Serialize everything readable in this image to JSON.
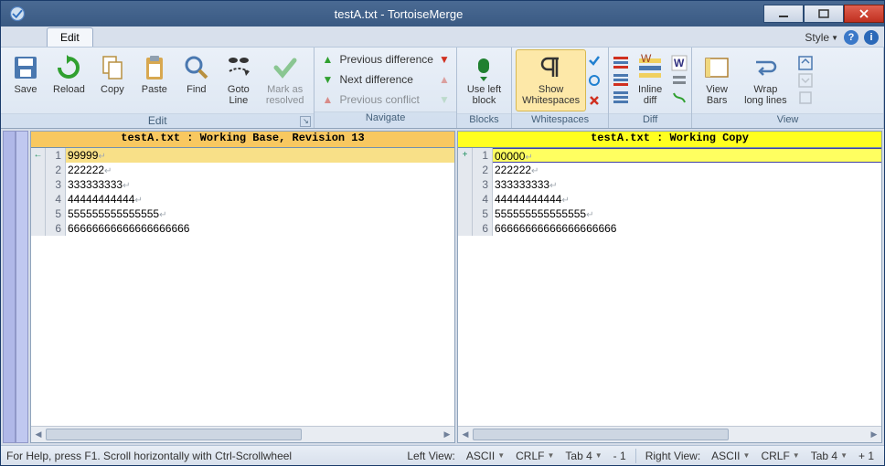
{
  "window_title": "testA.txt - TortoiseMerge",
  "tabs": {
    "edit": "Edit"
  },
  "style_menu": "Style",
  "ribbon": {
    "edit": {
      "label": "Edit",
      "save": "Save",
      "reload": "Reload",
      "copy": "Copy",
      "paste": "Paste",
      "find": "Find",
      "goto": "Goto\nLine",
      "mark": "Mark as\nresolved"
    },
    "navigate": {
      "label": "Navigate",
      "prev_diff": "Previous difference",
      "next_diff": "Next difference",
      "prev_conf": "Previous conflict"
    },
    "blocks": {
      "label": "Blocks",
      "use_left": "Use left\nblock"
    },
    "whitespaces": {
      "label": "Whitespaces",
      "show_ws": "Show\nWhitespaces"
    },
    "diff": {
      "label": "Diff",
      "inline": "Inline\ndiff"
    },
    "view": {
      "label": "View",
      "view_bars": "View\nBars",
      "wrap": "Wrap\nlong lines"
    }
  },
  "panes": {
    "left": {
      "header": "testA.txt : Working Base, Revision 13",
      "lines": [
        {
          "n": 1,
          "t": "99999",
          "changed": true,
          "mark": "←"
        },
        {
          "n": 2,
          "t": "222222"
        },
        {
          "n": 3,
          "t": "333333333"
        },
        {
          "n": 4,
          "t": "44444444444"
        },
        {
          "n": 5,
          "t": "555555555555555"
        },
        {
          "n": 6,
          "t": "66666666666666666666",
          "noeol": true
        }
      ]
    },
    "right": {
      "header": "testA.txt : Working Copy",
      "lines": [
        {
          "n": 1,
          "t": "00000",
          "changed": true,
          "mark": "+"
        },
        {
          "n": 2,
          "t": "222222"
        },
        {
          "n": 3,
          "t": "333333333"
        },
        {
          "n": 4,
          "t": "44444444444"
        },
        {
          "n": 5,
          "t": "555555555555555"
        },
        {
          "n": 6,
          "t": "66666666666666666666",
          "noeol": true
        }
      ]
    }
  },
  "status": {
    "help": "For Help, press F1. Scroll horizontally with Ctrl-Scrollwheel",
    "left_view": "Left View:",
    "right_view": "Right View:",
    "encoding": "ASCII",
    "eol": "CRLF",
    "tab": "Tab 4",
    "left_delta": "- 1",
    "right_delta": "+ 1"
  }
}
